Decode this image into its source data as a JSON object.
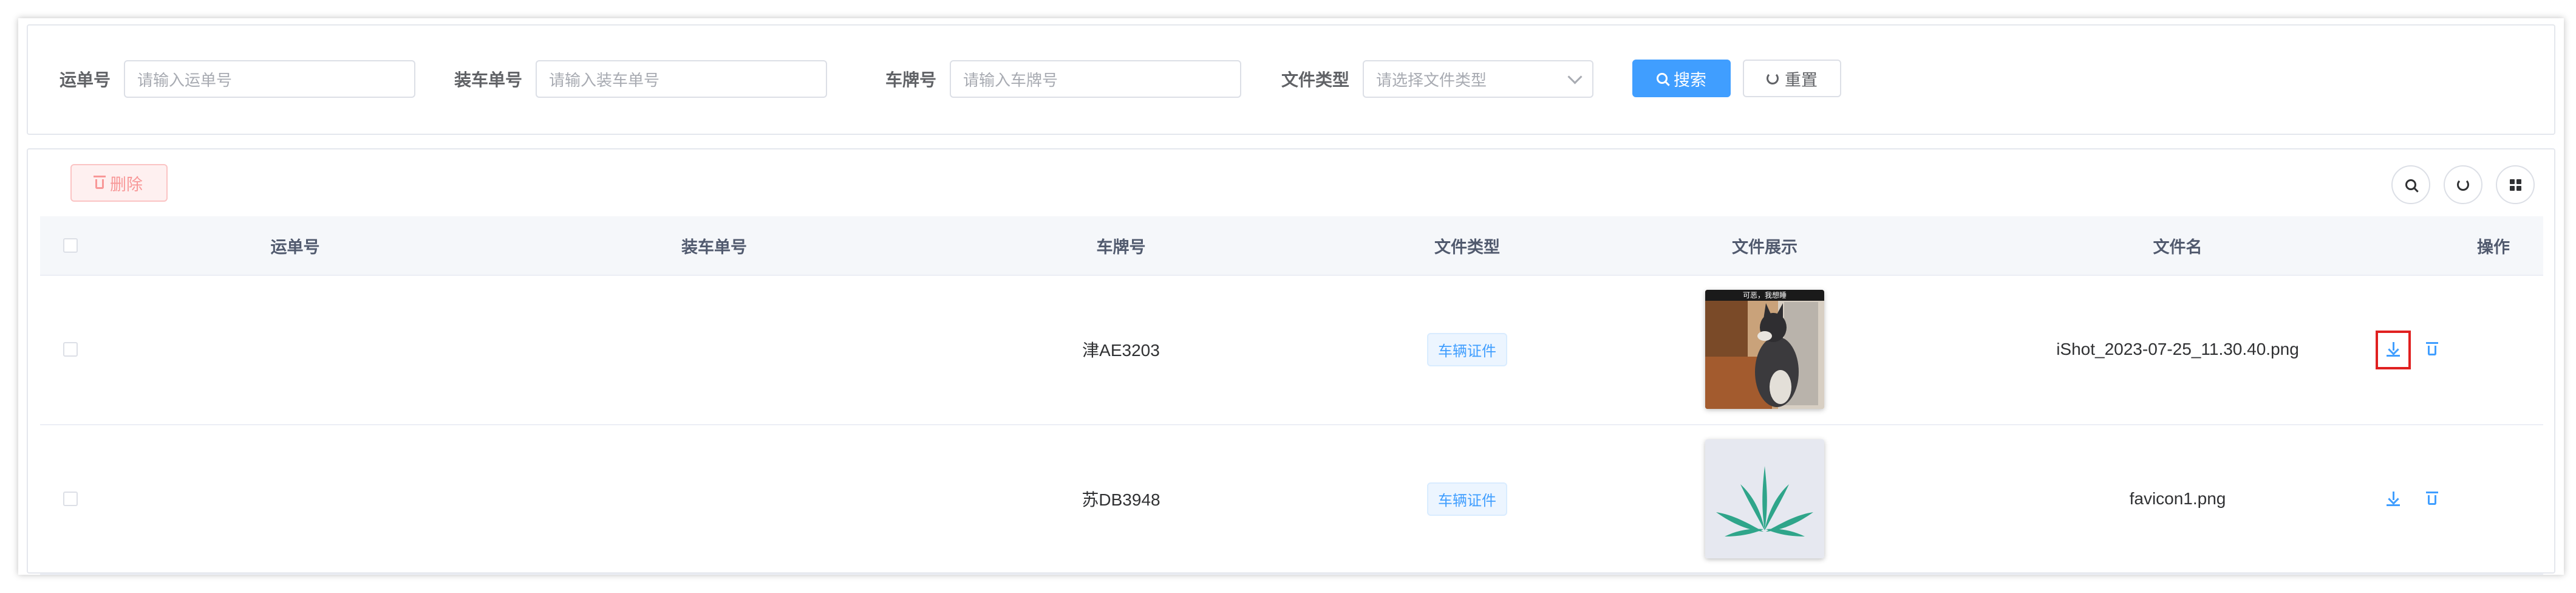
{
  "search": {
    "waybill_label": "运单号",
    "waybill_placeholder": "请输入运单号",
    "loading_label": "装车单号",
    "loading_placeholder": "请输入装车单号",
    "plate_label": "车牌号",
    "plate_placeholder": "请输入车牌号",
    "filetype_label": "文件类型",
    "filetype_placeholder": "请选择文件类型",
    "search_button": "搜索",
    "reset_button": "重置"
  },
  "toolbar": {
    "delete_button": "删除",
    "icons": [
      "search-icon",
      "refresh-icon",
      "grid-icon"
    ]
  },
  "table": {
    "columns": [
      "运单号",
      "装车单号",
      "车牌号",
      "文件类型",
      "文件展示",
      "文件名",
      "操作"
    ],
    "rows": [
      {
        "waybill": "",
        "loading_no": "",
        "plate": "津AE3203",
        "file_type": "车辆证件",
        "preview_caption": "可恶，我想睡",
        "file_name": "iShot_2023-07-25_11.30.40.png"
      },
      {
        "waybill": "",
        "loading_no": "",
        "plate": "苏DB3948",
        "file_type": "车辆证件",
        "preview_caption": "",
        "file_name": "favicon1.png"
      }
    ]
  },
  "colors": {
    "primary": "#409eff",
    "danger": "#f56c6c",
    "highlight": "#e02020",
    "leaf": "#2fa58a"
  }
}
